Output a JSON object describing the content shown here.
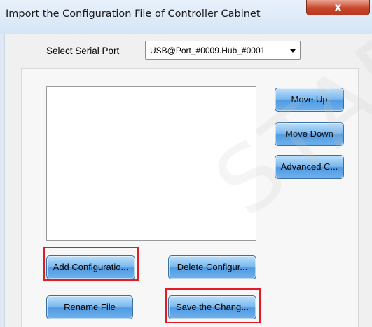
{
  "window": {
    "title": "Import the Configuration File of Controller Cabinet",
    "close_glyph": "x"
  },
  "serial_port": {
    "label": "Select Serial Port",
    "selected": "USB@Port_#0009.Hub_#0001"
  },
  "buttons": {
    "move_up": "Move Up",
    "move_down": "Move Down",
    "advanced": "Advanced C...",
    "add_configuration": "Add Configuratio...",
    "delete_configuration": "Delete Configur...",
    "rename_file": "Rename File",
    "save_changes": "Save the Chang..."
  },
  "watermark": "STAR",
  "colors": {
    "button_blue": "#6fb0ec",
    "highlight_red": "#e31b23",
    "close_red": "#c8472c"
  },
  "icons": {
    "close": "close-icon",
    "dropdown": "chevron-down-icon"
  }
}
